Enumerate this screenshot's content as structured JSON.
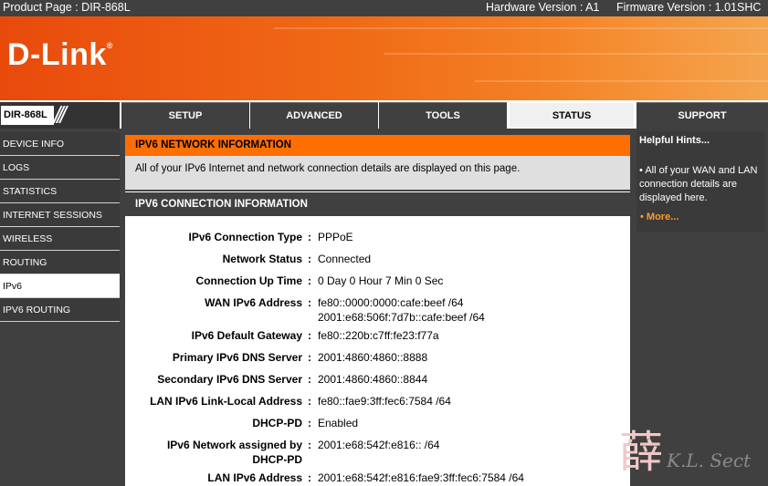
{
  "topbar": {
    "product": "Product Page : DIR-868L",
    "hardware": "Hardware Version : A1",
    "firmware": "Firmware Version : 1.01SHC"
  },
  "banner": {
    "logo": "D-Link",
    "logo_mark": "®"
  },
  "model": "DIR-868L",
  "tabs": [
    {
      "label": "SETUP"
    },
    {
      "label": "ADVANCED"
    },
    {
      "label": "TOOLS"
    },
    {
      "label": "STATUS"
    },
    {
      "label": "SUPPORT"
    }
  ],
  "sidebar": {
    "items": [
      {
        "label": "DEVICE INFO"
      },
      {
        "label": "LOGS"
      },
      {
        "label": "STATISTICS"
      },
      {
        "label": "INTERNET SESSIONS"
      },
      {
        "label": "WIRELESS"
      },
      {
        "label": "ROUTING"
      },
      {
        "label": "IPv6"
      },
      {
        "label": "IPV6 ROUTING"
      }
    ]
  },
  "info_panel": {
    "title": "IPV6 NETWORK INFORMATION",
    "text": "All of your IPv6 Internet and network connection details are displayed on this page."
  },
  "conn": {
    "title": "IPV6 CONNECTION INFORMATION",
    "rows": [
      {
        "label": "IPv6 Connection Type",
        "value": "PPPoE"
      },
      {
        "label": "Network Status",
        "value": "Connected"
      },
      {
        "label": "Connection Up Time",
        "value": "0 Day 0 Hour 7 Min 0 Sec"
      },
      {
        "label": "WAN IPv6 Address",
        "value": "fe80::0000:0000:cafe:beef /64",
        "value2": "2001:e68:506f:7d7b::cafe:beef /64"
      },
      {
        "label": "IPv6 Default Gateway",
        "value": "fe80::220b:c7ff:fe23:f77a"
      },
      {
        "label": "Primary IPv6 DNS Server",
        "value": "2001:4860:4860::8888"
      },
      {
        "label": "Secondary IPv6 DNS Server",
        "value": "2001:4860:4860::8844"
      },
      {
        "label": "LAN IPv6 Link-Local Address",
        "value": "fe80::fae9:3ff:fec6:7584 /64"
      },
      {
        "label": "DHCP-PD",
        "value": "Enabled"
      },
      {
        "label": "IPv6 Network assigned by",
        "label2": "DHCP-PD",
        "value": "2001:e68:542f:e816:: /64"
      },
      {
        "label": "LAN IPv6 Address",
        "value": "2001:e68:542f:e816:fae9:3ff:fec6:7584 /64"
      }
    ],
    "colon": ":"
  },
  "hints": {
    "title": "Helpful Hints...",
    "bullet": "•",
    "text": "All of your WAN and LAN connection details are displayed here.",
    "more": "More..."
  },
  "watermark": {
    "glyph": "薛",
    "signature": "K.L. Sect"
  },
  "colors": {
    "accent_orange": "#ff6f00",
    "dark_gray": "#404040",
    "link_orange": "#ff9a2e"
  }
}
